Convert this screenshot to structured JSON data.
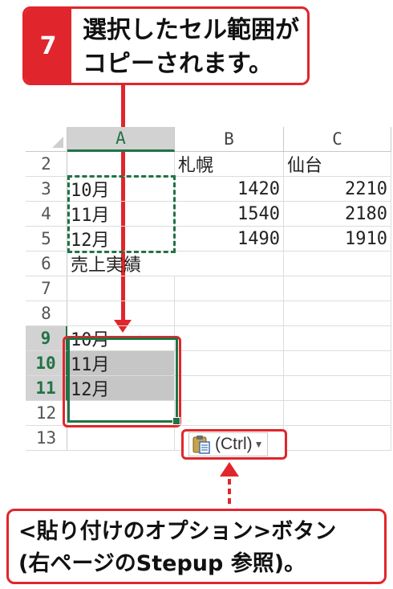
{
  "callout_top": {
    "step_number": "7",
    "line1": "選択したセル範囲が",
    "line2": "コピーされます。"
  },
  "sheet": {
    "columns": [
      "A",
      "B",
      "C"
    ],
    "rows": [
      {
        "num": "2",
        "a": "",
        "b": "札幌",
        "c": "仙台"
      },
      {
        "num": "3",
        "a": "10月",
        "b": "1420",
        "c": "2210"
      },
      {
        "num": "4",
        "a": "11月",
        "b": "1540",
        "c": "2180"
      },
      {
        "num": "5",
        "a": "12月",
        "b": "1490",
        "c": "1910"
      },
      {
        "num": "6",
        "a": "売上実績",
        "b": "",
        "c": ""
      },
      {
        "num": "7",
        "a": "",
        "b": "",
        "c": ""
      },
      {
        "num": "8",
        "a": "",
        "b": "",
        "c": ""
      },
      {
        "num": "9",
        "a": "10月",
        "b": "",
        "c": ""
      },
      {
        "num": "10",
        "a": "11月",
        "b": "",
        "c": ""
      },
      {
        "num": "11",
        "a": "12月",
        "b": "",
        "c": ""
      },
      {
        "num": "12",
        "a": "",
        "b": "",
        "c": ""
      },
      {
        "num": "13",
        "a": "",
        "b": "",
        "c": ""
      }
    ]
  },
  "paste_options": {
    "label": "(Ctrl)",
    "icon": "clipboard-icon"
  },
  "callout_bottom": {
    "line1": "<貼り付けのオプション>ボタン",
    "line2": "(右ページのStepup 参照)。"
  },
  "colors": {
    "accent_red": "#e0262c",
    "excel_green": "#217346",
    "selection_grey": "#c6c6c6"
  }
}
